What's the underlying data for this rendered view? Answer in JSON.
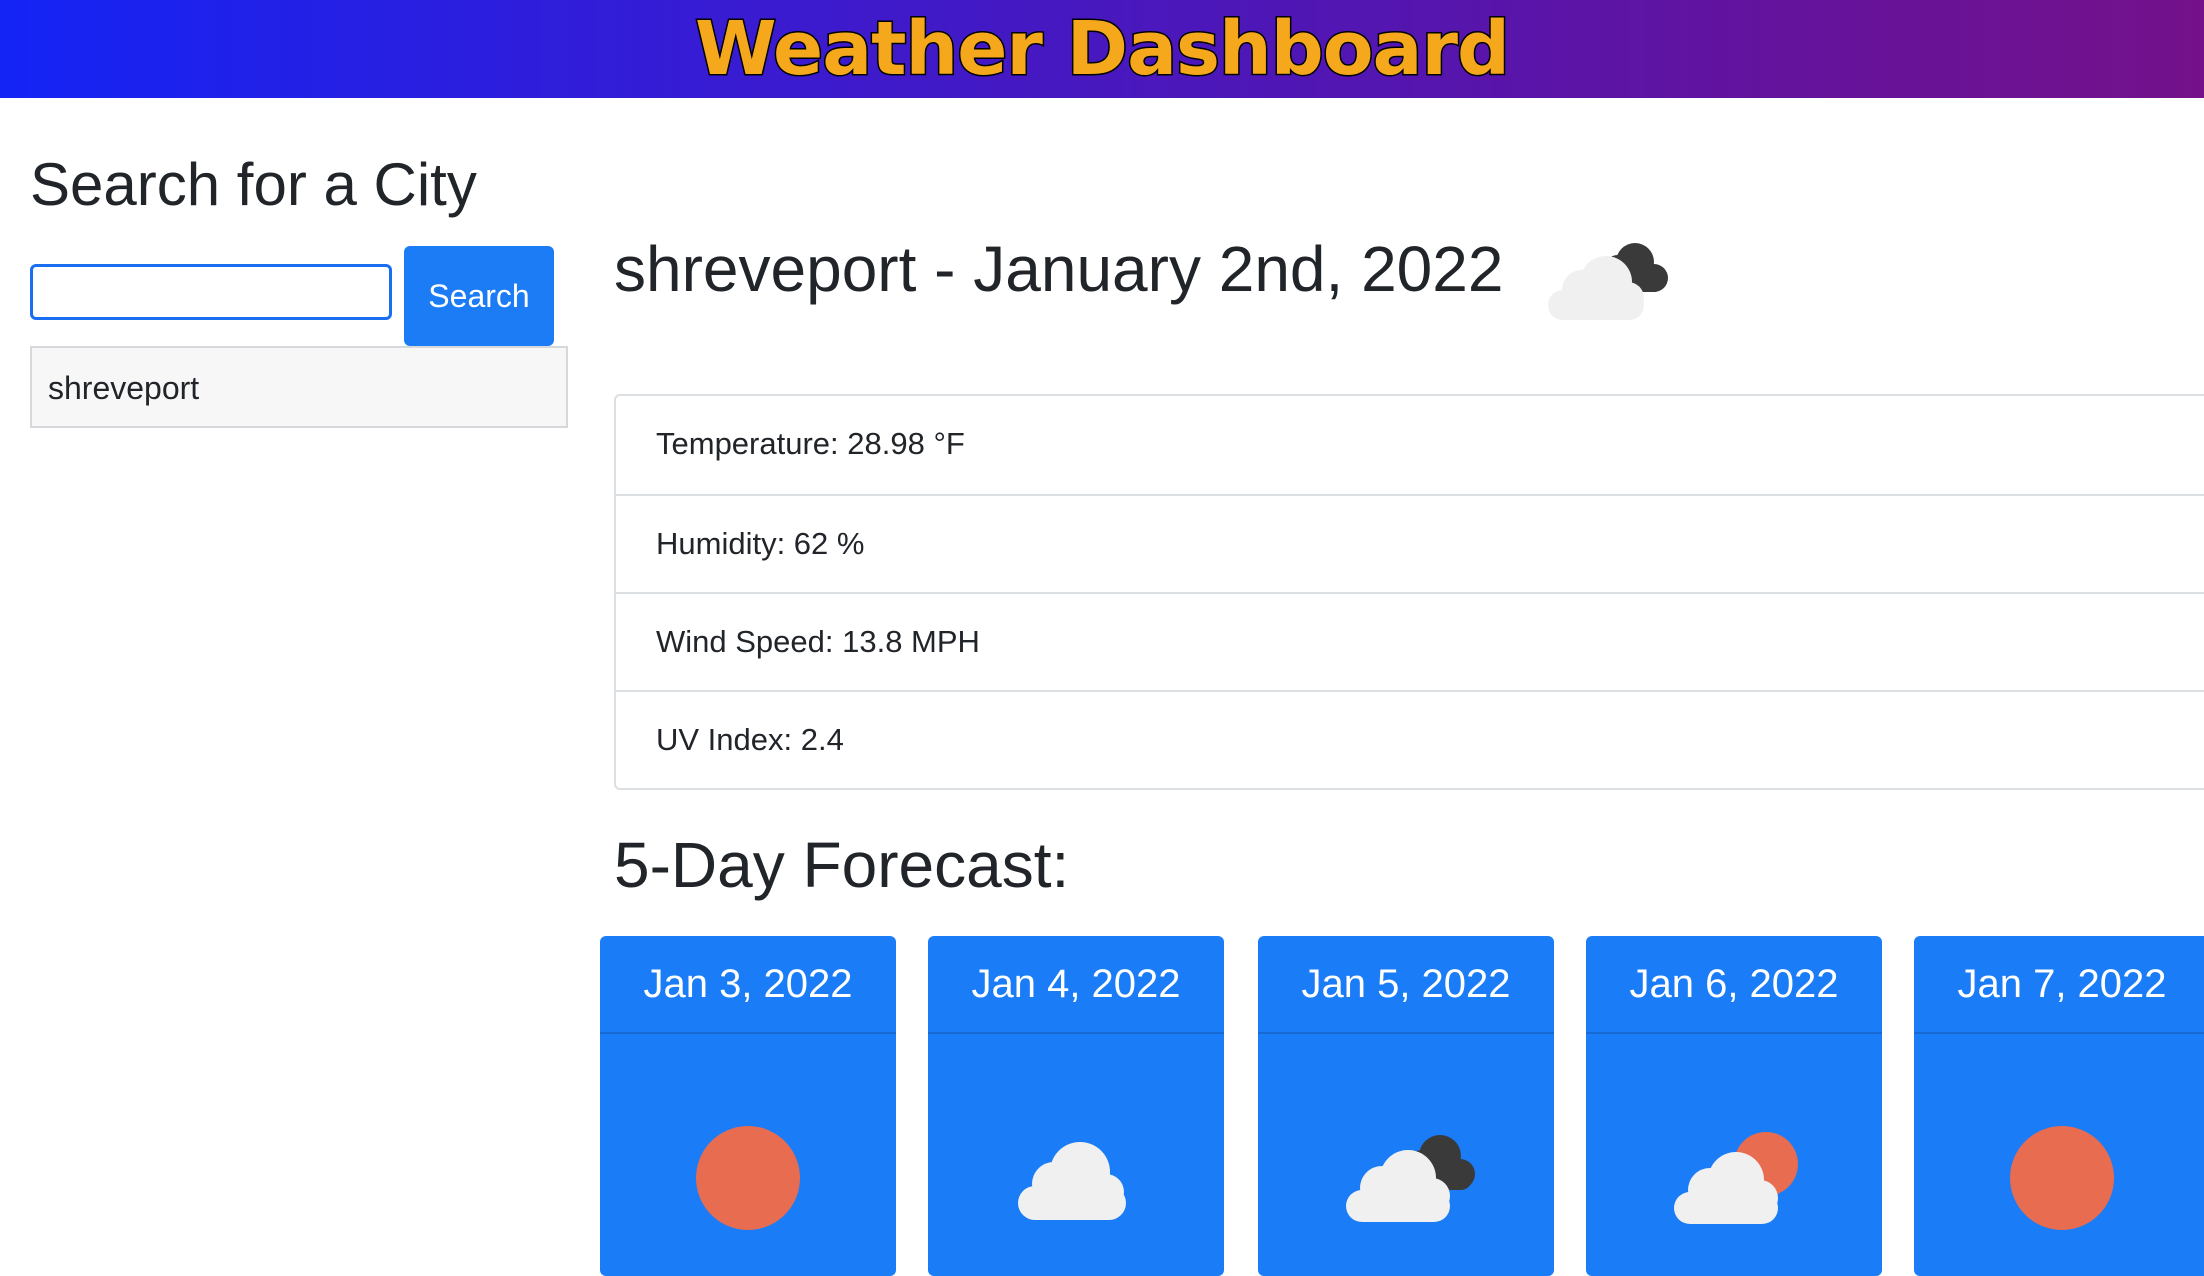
{
  "header": {
    "title": "Weather Dashboard"
  },
  "sidebar": {
    "heading": "Search for a City",
    "search": {
      "value": "",
      "placeholder": "",
      "button_label": "Search"
    },
    "history": [
      "shreveport"
    ]
  },
  "current": {
    "title": "shreveport - January 2nd, 2022",
    "icon": "cloudy-icon",
    "stats": [
      "Temperature: 28.98 °F",
      "Humidity: 62 %",
      "Wind Speed: 13.8 MPH",
      "UV Index: 2.4"
    ]
  },
  "forecast": {
    "heading": "5-Day Forecast:",
    "days": [
      {
        "date": "Jan 3, 2022",
        "icon": "sun-icon"
      },
      {
        "date": "Jan 4, 2022",
        "icon": "cloud-icon"
      },
      {
        "date": "Jan 5, 2022",
        "icon": "cloudy-icon"
      },
      {
        "date": "Jan 6, 2022",
        "icon": "partly-cloudy-icon"
      },
      {
        "date": "Jan 7, 2022",
        "icon": "sun-icon"
      }
    ]
  },
  "colors": {
    "accent": "#1a7df7",
    "title_text": "#f5a81c",
    "sun": "#e86c4f",
    "cloud_light": "#f0f0f0",
    "cloud_dark": "#3a3a3a"
  }
}
